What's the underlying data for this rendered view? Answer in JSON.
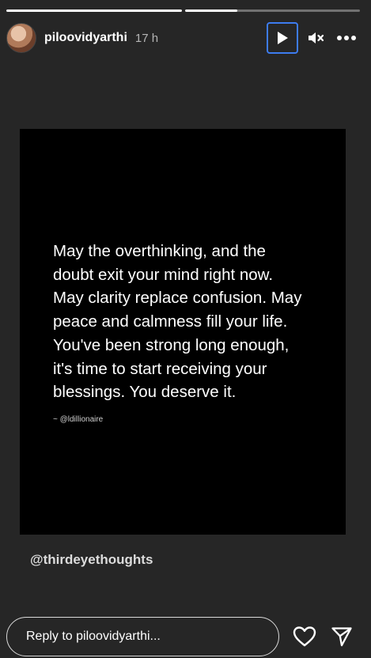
{
  "story": {
    "progress_segments": [
      {
        "fill": 1.0
      },
      {
        "fill": 0.3
      }
    ],
    "user": {
      "username": "piloovidyarthi",
      "time_ago": "17 h",
      "avatar_icon": "profile-photo"
    },
    "controls": {
      "play_icon": "play-icon",
      "mute_icon": "muted-speaker-icon",
      "more_icon": "more-options-icon"
    },
    "card": {
      "quote": "May the overthinking, and the\ndoubt exit your mind right now.\nMay clarity replace confusion. May\npeace and calmness fill your life.\nYou've been strong long enough,\nit's time to start receiving your\nblessings. You deserve it.",
      "attribution": "~ @ldillionaire"
    },
    "mention": "@thirdeyethoughts",
    "reply": {
      "placeholder": "Reply to piloovidyarthi...",
      "like_icon": "heart-icon",
      "share_icon": "send-icon"
    }
  }
}
